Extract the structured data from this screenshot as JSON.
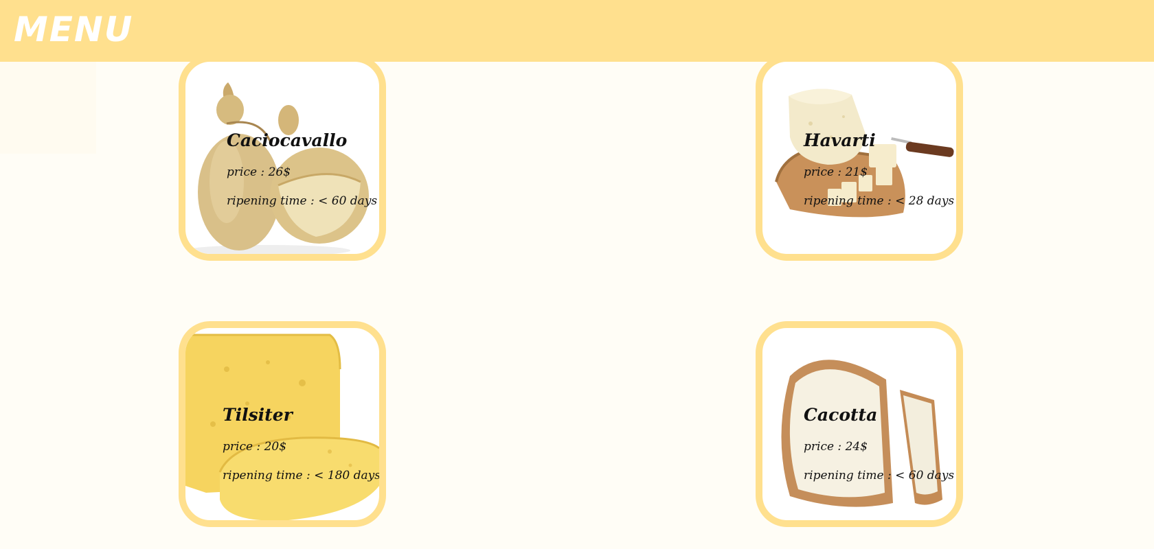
{
  "header": {
    "title": "MENU"
  },
  "cheeses": [
    {
      "name": "Caciocavallo",
      "price": "price : 26$",
      "ripening": "ripening time : < 60 days",
      "image_icon": "caciocavallo-image"
    },
    {
      "name": "Havarti",
      "price": "price : 21$",
      "ripening": "ripening time : < 28 days",
      "image_icon": "havarti-image"
    },
    {
      "name": "Tilsiter",
      "price": "price : 20$",
      "ripening": "ripening time : < 180 days",
      "image_icon": "tilsiter-image"
    },
    {
      "name": "Cacotta",
      "price": "price : 24$",
      "ripening": "ripening time : < 60 days",
      "image_icon": "cacotta-image"
    }
  ],
  "colors": {
    "accent": "#ffe08e",
    "background": "#fffdf6",
    "card_bg": "#ffffff"
  }
}
